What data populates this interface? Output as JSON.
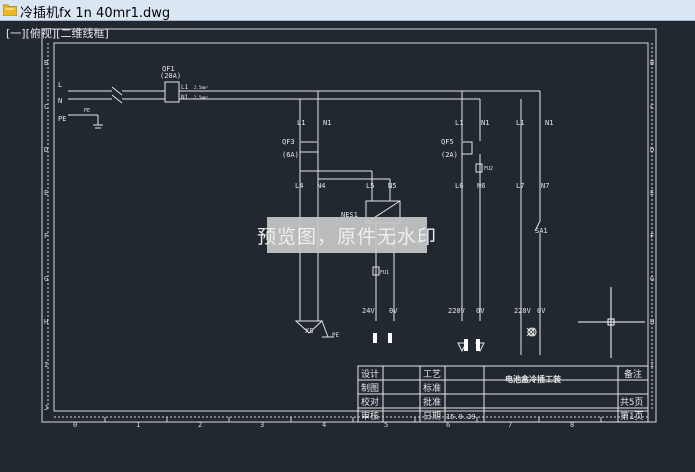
{
  "window": {
    "title": "冷插机fx 1n 40mr1.dwg",
    "icon": "folder-dwg-icon"
  },
  "viewport": {
    "label": "[一][俯视][二维线框]"
  },
  "border": {
    "row_letters": [
      "B",
      "C",
      "D",
      "E",
      "F",
      "G",
      "H",
      "I",
      "J"
    ],
    "col_numbers": [
      "0",
      "1",
      "2",
      "3",
      "4",
      "5",
      "6",
      "7",
      "8"
    ]
  },
  "power_input": {
    "breaker": "QF1",
    "rating": "(20A)",
    "line_L": "L",
    "line_N": "N",
    "earth": "PE",
    "earth_tag": "PE",
    "out_L": "L1",
    "out_N": "N1",
    "wire_L": "2.5mm²",
    "wire_N": "2.5mm²"
  },
  "circuit1": {
    "in_L": "L1",
    "in_N": "N1",
    "breaker": "QF3",
    "rating": "(6A)",
    "out_L": "L4",
    "out_N": "N4",
    "load": "XS",
    "load_pe": "PE"
  },
  "circuit2": {
    "out_L": "L5",
    "out_N": "N5",
    "device": "NES1",
    "fuse": "FU1",
    "v_pos": "24V",
    "v_neg": "0V"
  },
  "circuit3": {
    "in_L": "L1",
    "in_N": "N1",
    "breaker": "QF5",
    "rating": "(2A)",
    "fuse": "FU2",
    "out_L": "L6",
    "out_N": "N6",
    "v_pos": "220V",
    "v_neg": "0V"
  },
  "circuit4": {
    "in_L": "L1",
    "in_N": "N1",
    "out_L": "L7",
    "out_N": "N7",
    "switch": "SA1",
    "v_pos": "220V",
    "v_neg": "0V"
  },
  "title_block": {
    "design": "设计",
    "process": "工艺",
    "drawn": "制图",
    "standard": "标准",
    "checked": "校对",
    "approved": "批准",
    "reviewed": "审核",
    "date_label": "日期",
    "date": "15.9.29",
    "project": "电池盒冷插工装",
    "remarks": "备注",
    "total_pages": "共5页",
    "page_no": "第1页"
  },
  "watermark": "预览图，原件无水印"
}
